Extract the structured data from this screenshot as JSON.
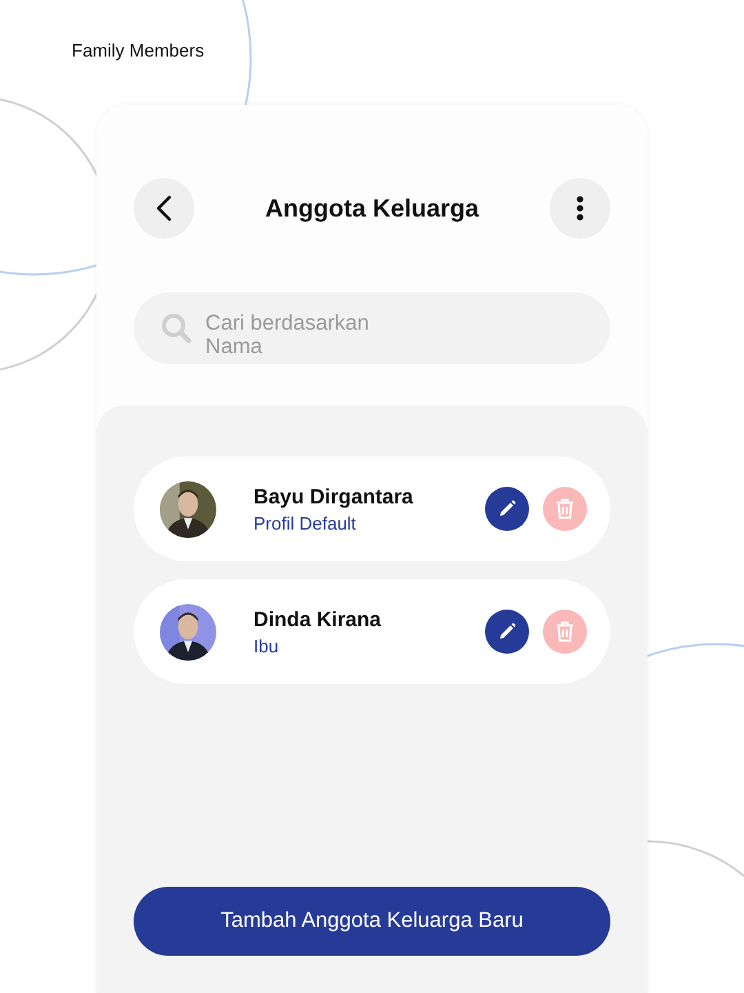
{
  "page_label": "Family Members",
  "header": {
    "title": "Anggota Keluarga"
  },
  "search": {
    "placeholder": "Cari berdasarkan Nama"
  },
  "members": [
    {
      "name": "Bayu Dirgantara",
      "relation": "Profil Default"
    },
    {
      "name": "Dinda Kirana",
      "relation": "Ibu"
    }
  ],
  "add_button": "Tambah Anggota Keluarga Baru"
}
